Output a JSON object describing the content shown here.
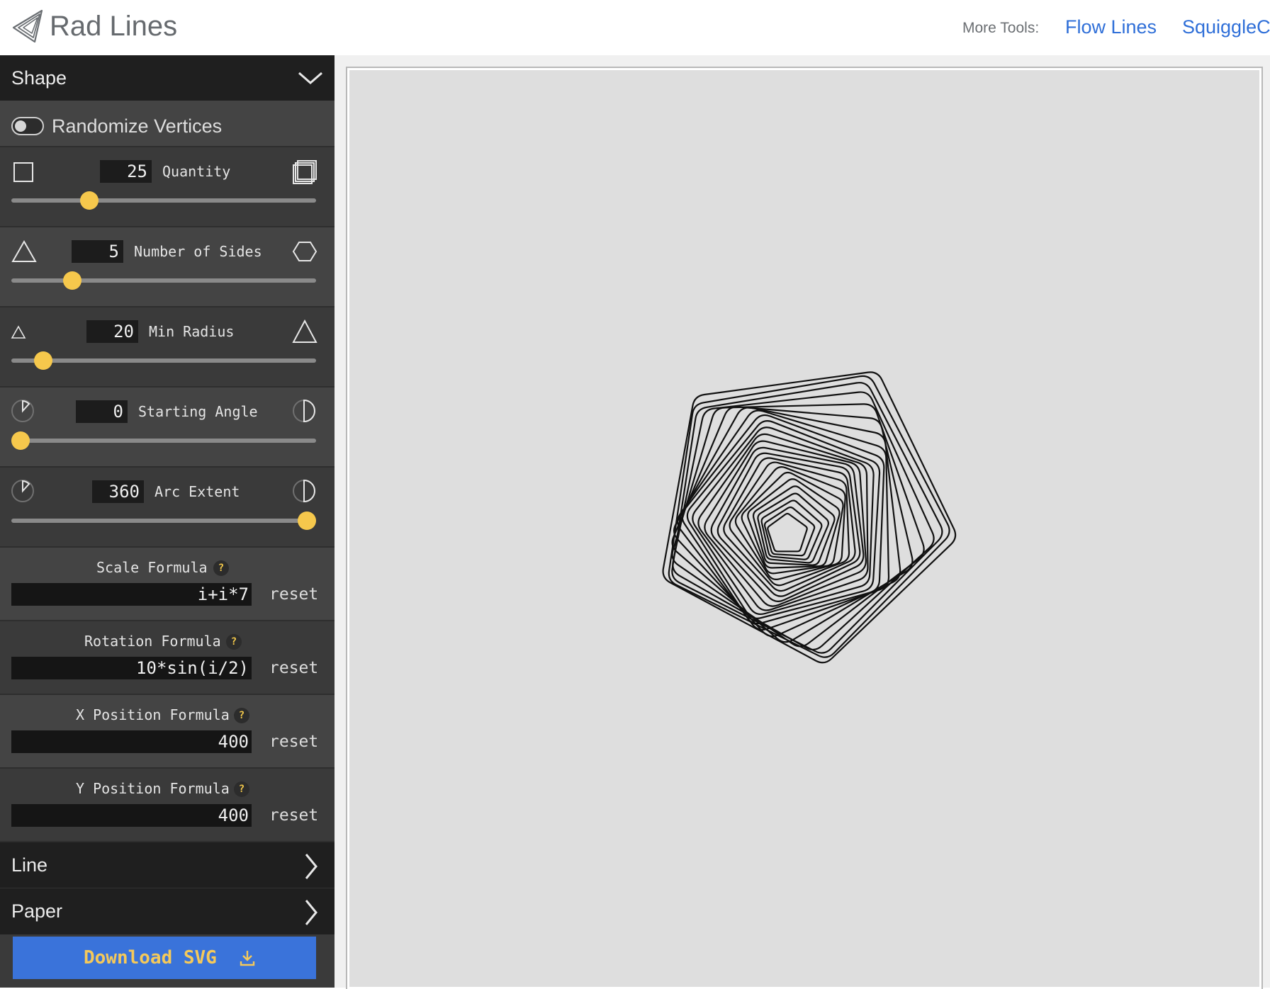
{
  "header": {
    "app_title": "Rad Lines",
    "more_tools_label": "More Tools:",
    "tool_links": [
      "Flow Lines",
      "SquiggleC"
    ]
  },
  "sidebar": {
    "shape_section": {
      "label": "Shape",
      "expanded": true
    },
    "randomize_vertices": {
      "label": "Randomize Vertices",
      "enabled": false
    },
    "sliders": [
      {
        "label": "Quantity",
        "value": "25",
        "level": 0.24
      },
      {
        "label": "Number of Sides",
        "value": "5",
        "level": 0.18
      },
      {
        "label": "Min Radius",
        "value": "20",
        "level": 0.08
      },
      {
        "label": "Starting Angle",
        "value": "0",
        "level": 0.0
      },
      {
        "label": "Arc Extent",
        "value": "360",
        "level": 1.0
      }
    ],
    "formulas": [
      {
        "label": "Scale Formula",
        "help": "?",
        "value": "i+i*7",
        "reset": "reset"
      },
      {
        "label": "Rotation Formula",
        "help": "?",
        "value": "10*sin(i/2)",
        "reset": "reset"
      },
      {
        "label": "X Position Formula",
        "help": "?",
        "value": "400",
        "reset": "reset"
      },
      {
        "label": "Y Position Formula",
        "help": "?",
        "value": "400",
        "reset": "reset"
      }
    ],
    "line_section": {
      "label": "Line",
      "expanded": false
    },
    "paper_section": {
      "label": "Paper",
      "expanded": false
    },
    "download_label": "Download SVG"
  },
  "icons": {
    "logo": "rad-lines-logo",
    "collapse": "chevron-down-icon",
    "expand": "chevron-right-icon",
    "download": "download-icon"
  },
  "colors": {
    "accent_yellow": "#f6c84c",
    "download_blue": "#3a73da",
    "link_blue": "#2f6fd8",
    "paper": "#dedede",
    "stroke": "#111111"
  }
}
